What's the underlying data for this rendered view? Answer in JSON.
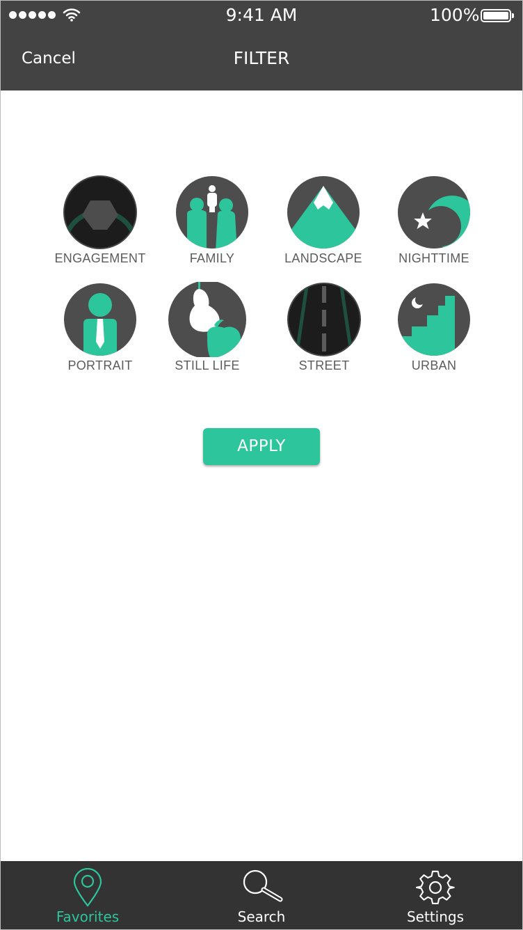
{
  "status_bar": {
    "time": "9:41 AM",
    "battery_percent": "100%"
  },
  "nav": {
    "cancel_label": "Cancel",
    "title": "FILTER"
  },
  "categories": [
    {
      "label": "ENGAGEMENT",
      "icon": "ring-icon"
    },
    {
      "label": "FAMILY",
      "icon": "family-icon"
    },
    {
      "label": "LANDSCAPE",
      "icon": "mountain-icon"
    },
    {
      "label": "NIGHTTIME",
      "icon": "moon-star-icon"
    },
    {
      "label": "PORTRAIT",
      "icon": "person-tie-icon"
    },
    {
      "label": "STILL LIFE",
      "icon": "pear-apple-icon"
    },
    {
      "label": "STREET",
      "icon": "road-icon"
    },
    {
      "label": "URBAN",
      "icon": "skyline-moon-icon"
    }
  ],
  "apply_label": "APPLY",
  "tabs": [
    {
      "label": "Favorites",
      "icon": "location-pin-icon",
      "active": true
    },
    {
      "label": "Search",
      "icon": "magnifier-icon",
      "active": false
    },
    {
      "label": "Settings",
      "icon": "gear-icon",
      "active": false
    }
  ],
  "colors": {
    "accent": "#2dc59c",
    "header": "#434343",
    "tabbar": "#333333",
    "icon_bg": "#4d4d4d"
  }
}
